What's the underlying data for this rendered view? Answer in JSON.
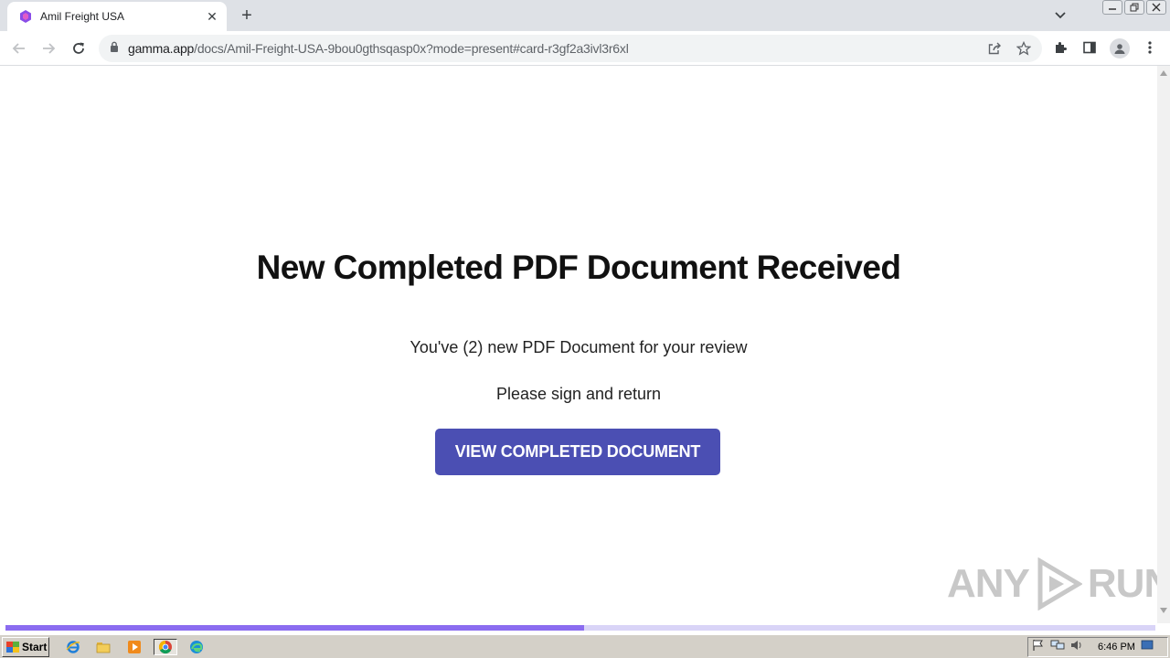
{
  "browser": {
    "tab_title": "Amil Freight USA",
    "new_tab_symbol": "+",
    "close_symbol": "✕",
    "url_host": "gamma.app",
    "url_path": "/docs/Amil-Freight-USA-9bou0gthsqasp0x?mode=present#card-r3gf2a3ivl3r6xl"
  },
  "page": {
    "heading": "New Completed PDF Document Received",
    "line1": "You've (2) new PDF Document for your review",
    "line2": "Please sign and return",
    "cta_label": "VIEW COMPLETED DOCUMENT",
    "accent_color": "#4b4fb3",
    "presentation_progress": 0.503
  },
  "watermark": {
    "left": "ANY",
    "right": "RUN"
  },
  "taskbar": {
    "start_label": "Start",
    "clock": "6:46 PM",
    "quick_launch": [
      "ie-icon",
      "explorer-icon",
      "media-player-icon",
      "chrome-icon",
      "edge-icon"
    ]
  }
}
